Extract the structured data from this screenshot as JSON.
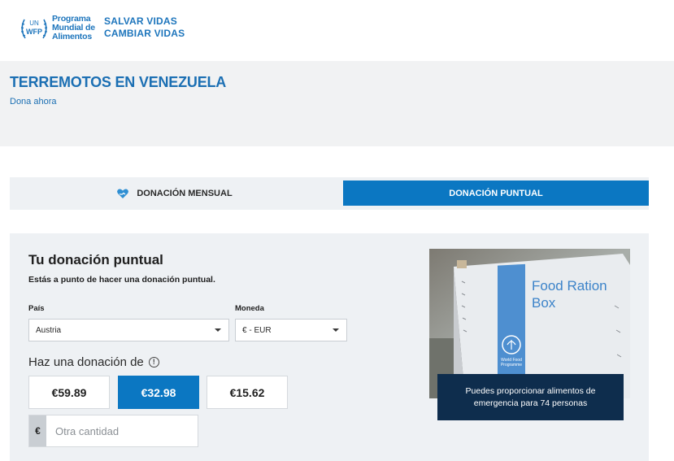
{
  "header": {
    "logo": {
      "line1": "Programa",
      "line2": "Mundial de",
      "line3": "Alimentos",
      "emblem_top": "UN",
      "emblem_bottom": "WFP"
    },
    "tagline_1": "SALVAR VIDAS",
    "tagline_2": "CAMBIAR VIDAS"
  },
  "hero": {
    "title": "TERREMOTOS EN VENEZUELA",
    "subtitle": "Dona ahora"
  },
  "tabs": {
    "monthly": {
      "label": "DONACIÓN MENSUAL",
      "icon": "heart-hand-icon"
    },
    "one_time": {
      "label": "DONACIÓN PUNTUAL",
      "active": true
    }
  },
  "form": {
    "title": "Tu donación puntual",
    "description": "Estás a punto de hacer una donación puntual.",
    "country": {
      "label": "País",
      "value": "Austria"
    },
    "currency": {
      "label": "Moneda",
      "value": "€ - EUR"
    },
    "amount_label": "Haz una donación de",
    "amounts": [
      {
        "label": "€59.89",
        "selected": false
      },
      {
        "label": "€32.98",
        "selected": true
      },
      {
        "label": "€15.62",
        "selected": false
      }
    ],
    "other": {
      "currency_symbol": "€",
      "placeholder": "Otra cantidad"
    }
  },
  "image": {
    "box_text_1": "Food Ration",
    "box_text_2": "Box",
    "wfp_small_1": "World Food",
    "wfp_small_2": "Programme",
    "caption": "Puedes proporcionar alimentos de emergencia para 74 personas"
  },
  "colors": {
    "brand_blue": "#1d75bc",
    "active_tab": "#0b77c2",
    "caption_bg": "#0e2d4d",
    "panel_bg": "#eef1f4"
  }
}
